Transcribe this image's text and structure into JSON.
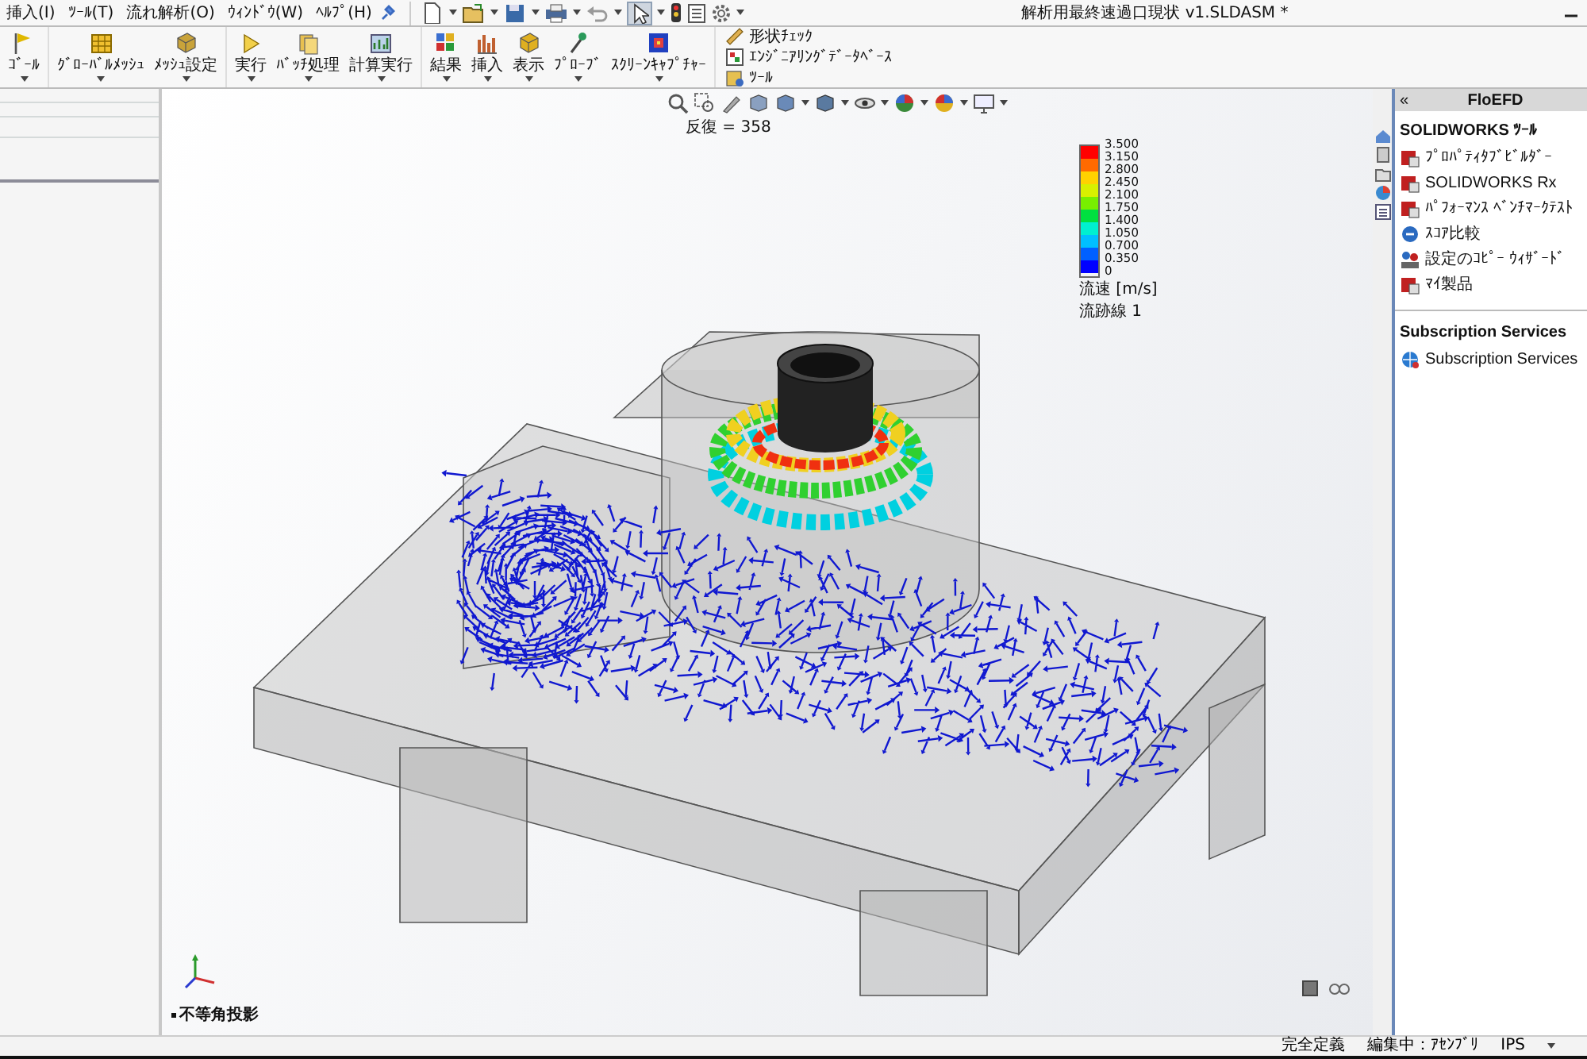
{
  "menu": [
    "挿入(I)",
    "ﾂｰﾙ(T)",
    "流れ解析(O)",
    "ｳｨﾝﾄﾞｳ(W)",
    "ﾍﾙﾌﾟ(H)"
  ],
  "window": {
    "title": "解析用最終速過口現状 v1.SLDASM *"
  },
  "ribbon": {
    "groups": [
      [
        "ｺﾞｰﾙ"
      ],
      [
        "ｸﾞﾛｰﾊﾞﾙﾒｯｼｭ",
        "ﾒｯｼｭ設定"
      ],
      [
        "実行",
        "ﾊﾞｯﾁ処理",
        "計算実行"
      ],
      [
        "結果",
        "挿入",
        "表示",
        "ﾌﾟﾛｰﾌﾞ",
        "ｽｸﾘｰﾝｷｬﾌﾟﾁｬｰ"
      ]
    ],
    "small_buttons": [
      "形状ﾁｪｯｸ",
      "ｴﾝｼﾞﾆｱﾘﾝｸﾞﾃﾞｰﾀﾍﾞｰｽ",
      "ﾂｰﾙ"
    ]
  },
  "viewport": {
    "iteration": "反復 = 358",
    "legend": {
      "ticks": [
        "3.500",
        "3.150",
        "2.800",
        "2.450",
        "2.100",
        "1.750",
        "1.400",
        "1.050",
        "0.700",
        "0.350",
        "0"
      ],
      "bands": [
        {
          "color": "#ff0000"
        },
        {
          "color": "#ff6a00"
        },
        {
          "color": "#ffd200"
        },
        {
          "color": "#d8f000"
        },
        {
          "color": "#78ee00"
        },
        {
          "color": "#00e040"
        },
        {
          "color": "#00f0d0"
        },
        {
          "color": "#00c0ff"
        },
        {
          "color": "#0060ff"
        },
        {
          "color": "#0000ff"
        }
      ],
      "quantity": "流速 [m/s]",
      "trajectory": "流跡線 1"
    },
    "view_name": "不等角投影"
  },
  "task_pane": {
    "collapse": "«",
    "title": "FloEFD",
    "sections": [
      {
        "heading": "SOLIDWORKS ﾂｰﾙ",
        "items": [
          "ﾌﾟﾛﾊﾟﾃｨﾀﾌﾞﾋﾞﾙﾀﾞｰ",
          "SOLIDWORKS Rx",
          "ﾊﾟﾌｫｰﾏﾝｽ ﾍﾞﾝﾁﾏｰｸﾃｽﾄ",
          "ｽｺｱ比較",
          "設定のｺﾋﾟｰ ｳｨｻﾞｰﾄﾞ",
          "ﾏｲ製品"
        ]
      },
      {
        "heading": "Subscription Services",
        "items": [
          "Subscription Services"
        ]
      }
    ]
  },
  "status_bar": [
    "完全定義",
    "編集中：ｱｾﾝﾌﾞﾘ",
    "IPS"
  ]
}
